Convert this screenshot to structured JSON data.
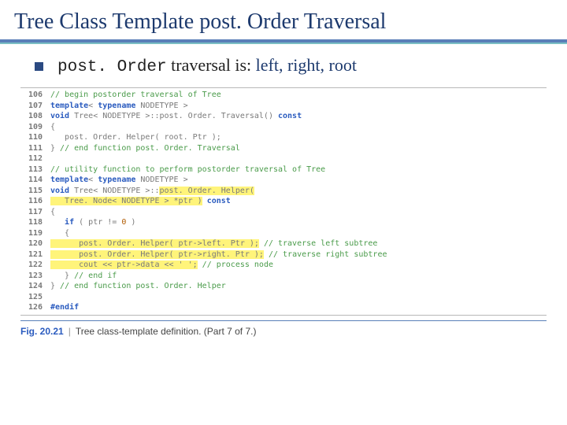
{
  "title": "Tree Class Template post. Order Traversal",
  "bullet": {
    "mono": "post. Order",
    "rest": " traversal is:  ",
    "accent": "left, right, root"
  },
  "code": {
    "lines": [
      {
        "n": "106",
        "cmt": "// begin postorder traversal of Tree"
      },
      {
        "n": "107",
        "kw1": "template",
        "plain1": "< ",
        "kw2": "typename",
        "plain2": " NODETYPE >"
      },
      {
        "n": "108",
        "kw1": "void",
        "plain1": " Tree< NODETYPE >::post. Order. Traversal() ",
        "kw2": "const"
      },
      {
        "n": "109",
        "plain1": "{"
      },
      {
        "n": "110",
        "plain1": "   post. Order. Helper( root. Ptr );"
      },
      {
        "n": "111",
        "plain1": "} ",
        "cmt": "// end function post. Order. Traversal"
      },
      {
        "n": "112",
        "plain1": ""
      },
      {
        "n": "113",
        "cmt": "// utility function to perform postorder traversal of Tree"
      },
      {
        "n": "114",
        "kw1": "template",
        "plain1": "< ",
        "kw2": "typename",
        "plain2": " NODETYPE >"
      },
      {
        "n": "115",
        "kw1": "void",
        "plain1": " Tree< NODETYPE >::",
        "hl": "post. Order. Helper("
      },
      {
        "n": "116",
        "hl": "   Tree. Node< NODETYPE > *ptr )",
        "plain1": " ",
        "kw1": "const"
      },
      {
        "n": "117",
        "plain1": "{"
      },
      {
        "n": "118",
        "kw1": "   if",
        "plain1": " ( ptr != ",
        "num": "0",
        "plain2": " )"
      },
      {
        "n": "119",
        "plain1": "   {"
      },
      {
        "n": "120",
        "hl": "      post. Order. Helper( ptr->left. Ptr );",
        "plain1": " ",
        "cmt": "// traverse left subtree"
      },
      {
        "n": "121",
        "hl": "      post. Order. Helper( ptr->right. Ptr );",
        "plain1": " ",
        "cmt": "// traverse right subtree"
      },
      {
        "n": "122",
        "hl": "      cout << ptr->data << ' ';",
        "plain1": " ",
        "cmt": "// process node"
      },
      {
        "n": "123",
        "plain1": "   } ",
        "cmt": "// end if"
      },
      {
        "n": "124",
        "plain1": "} ",
        "cmt": "// end function post. Order. Helper"
      },
      {
        "n": "125",
        "plain1": ""
      },
      {
        "n": "126",
        "kw1": "#endif"
      }
    ]
  },
  "caption": {
    "fig": "Fig. 20.21",
    "text": "Tree class-template definition. (Part 7 of 7.)"
  }
}
